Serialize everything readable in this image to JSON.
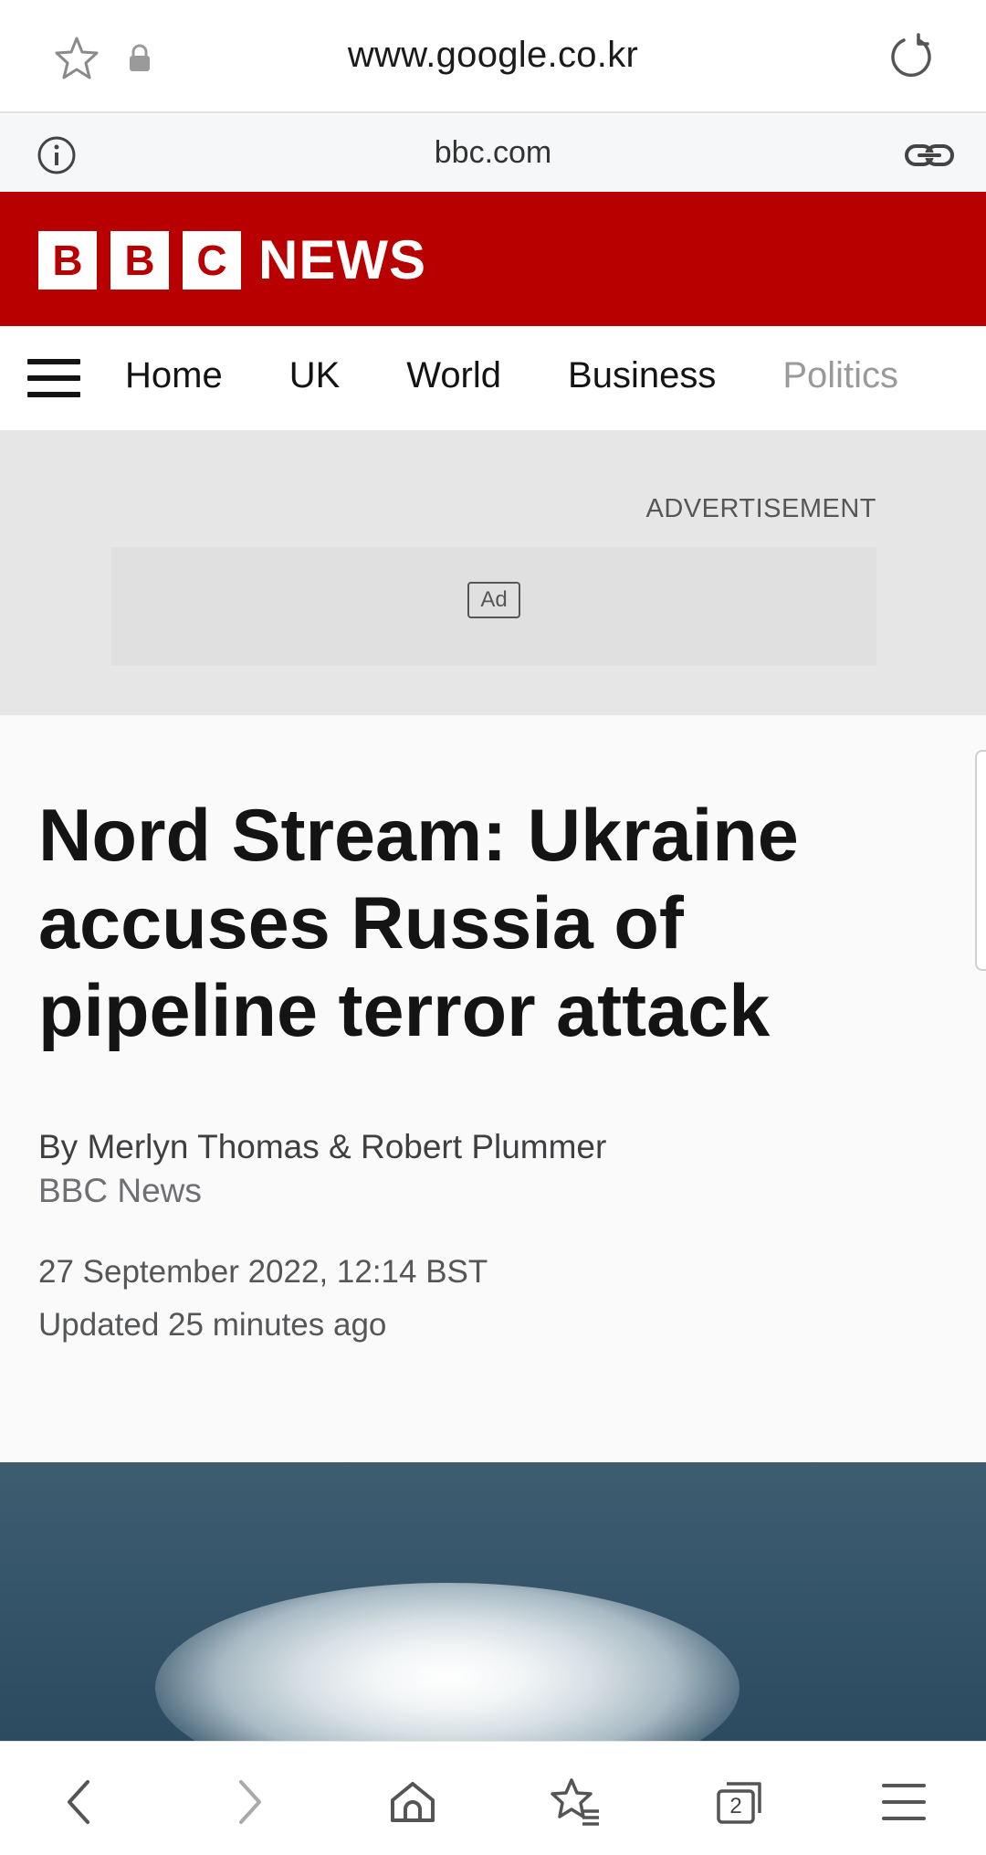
{
  "browser": {
    "url": "www.google.co.kr",
    "site_domain": "bbc.com",
    "tab_count": "2"
  },
  "bbc": {
    "logo_letters": [
      "B",
      "B",
      "C"
    ],
    "logo_word": "NEWS",
    "brand_color": "#b80000"
  },
  "nav": {
    "items": [
      "Home",
      "UK",
      "World",
      "Business",
      "Politics"
    ]
  },
  "ad": {
    "label": "ADVERTISEMENT",
    "badge": "Ad"
  },
  "article": {
    "headline": "Nord Stream: Ukraine accuses Russia of pipeline terror attack",
    "byline": "By Merlyn Thomas & Robert Plummer",
    "organization": "BBC News",
    "date": "27 September 2022, 12:14 BST",
    "updated": "Updated 25 minutes ago"
  },
  "icons": {
    "urlbar": [
      "star-icon",
      "lock-icon",
      "reload-icon"
    ],
    "sitebar": [
      "info-icon",
      "link-icon"
    ],
    "bottombar": [
      "back-icon",
      "forward-icon",
      "home-icon",
      "bookmarks-icon",
      "tabs-icon",
      "menu-icon"
    ]
  }
}
